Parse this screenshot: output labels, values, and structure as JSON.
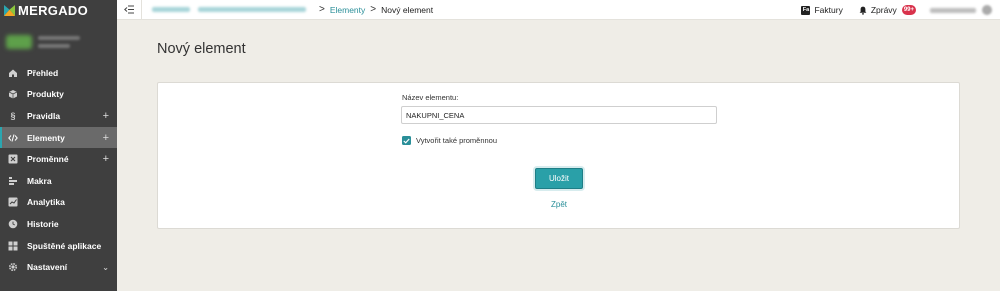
{
  "brand": {
    "name": "MERGADO",
    "accent": "#2aa0a8"
  },
  "sidebar": {
    "items": [
      {
        "label": "Přehled",
        "icon": "home-icon"
      },
      {
        "label": "Produkty",
        "icon": "box-icon"
      },
      {
        "label": "Pravidla",
        "icon": "section-icon",
        "plus": "+"
      },
      {
        "label": "Elementy",
        "icon": "code-icon",
        "plus": "+",
        "active": true
      },
      {
        "label": "Proměnné",
        "icon": "variable-icon",
        "plus": "+"
      },
      {
        "label": "Makra",
        "icon": "macro-icon"
      },
      {
        "label": "Analytika",
        "icon": "chart-icon"
      },
      {
        "label": "Historie",
        "icon": "history-icon"
      },
      {
        "label": "Spuštěné aplikace",
        "icon": "apps-icon"
      },
      {
        "label": "Nastavení",
        "icon": "gear-icon",
        "chevron": "⌄"
      }
    ]
  },
  "topbar": {
    "breadcrumb": {
      "sep1": ">",
      "link": "Elementy",
      "sep2": ">",
      "current": "Nový element"
    },
    "invoices": {
      "icon_text": "Fa",
      "label": "Faktury"
    },
    "messages": {
      "label": "Zprávy",
      "badge": "99+"
    }
  },
  "main": {
    "title": "Nový element",
    "form": {
      "name_label": "Název elementu:",
      "name_value": "NAKUPNI_CENA",
      "create_variable_label": "Vytvořit také proměnnou",
      "create_variable_checked": true,
      "save_label": "Uložit",
      "back_label": "Zpět"
    }
  }
}
